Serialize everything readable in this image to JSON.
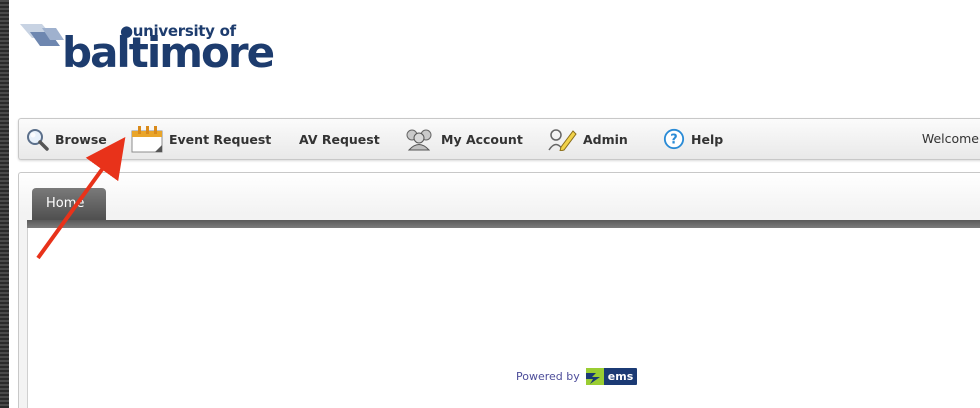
{
  "logo": {
    "small_text": "●university of",
    "big_text": "baltimore"
  },
  "nav": {
    "items": [
      {
        "label": "Browse",
        "icon": "magnifier-icon"
      },
      {
        "label": "Event Request",
        "icon": "calendar-icon"
      },
      {
        "label": "AV Request",
        "icon": ""
      },
      {
        "label": "My Account",
        "icon": "users-icon"
      },
      {
        "label": "Admin",
        "icon": "user-pencil-icon"
      },
      {
        "label": "Help",
        "icon": "help-icon"
      }
    ],
    "welcome_text": "Welcome"
  },
  "tabs": {
    "home_label": "Home"
  },
  "footer": {
    "powered_by": "Powered by",
    "brand": "ems"
  },
  "colors": {
    "logo_blue": "#1d3c6e",
    "tab_gray": "#5a5a5a",
    "annotation_arrow": "#e8321a",
    "ems_navy": "#1b3a74",
    "ems_green": "#9acd32"
  }
}
